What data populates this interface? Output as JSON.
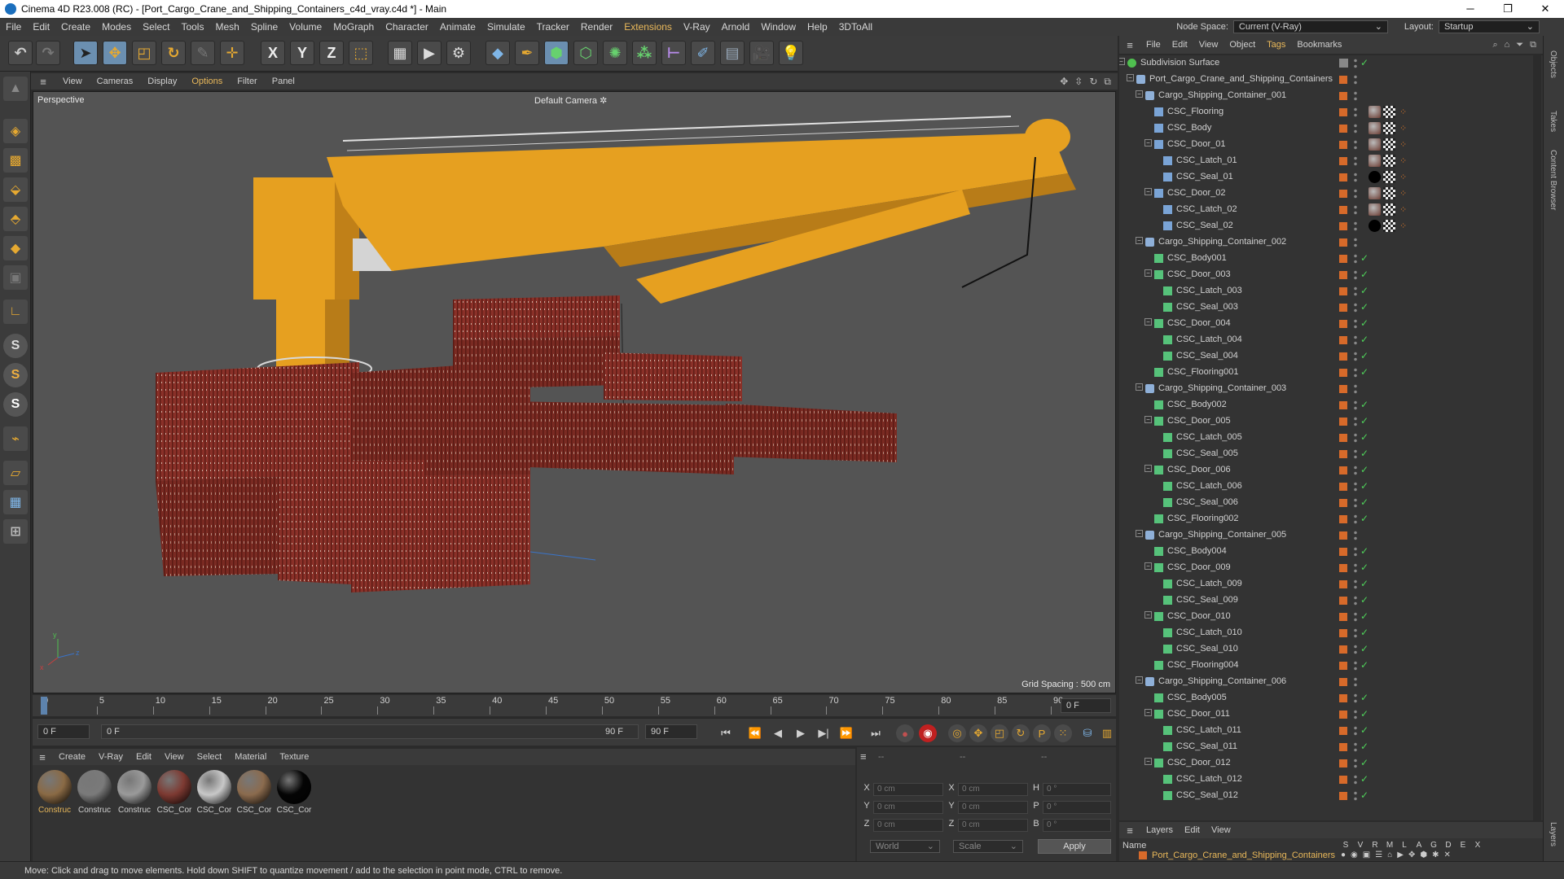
{
  "window": {
    "title": "Cinema 4D R23.008 (RC) - [Port_Cargo_Crane_and_Shipping_Containers_c4d_vray.c4d *] - Main",
    "min": "─",
    "restore": "❐",
    "close": "✕"
  },
  "menu": [
    "File",
    "Edit",
    "Create",
    "Modes",
    "Select",
    "Tools",
    "Mesh",
    "Spline",
    "Volume",
    "MoGraph",
    "Character",
    "Animate",
    "Simulate",
    "Tracker",
    "Render",
    "Extensions",
    "V-Ray",
    "Arnold",
    "Window",
    "Help",
    "3DToAll"
  ],
  "menu_highlight": "Extensions",
  "node_space": {
    "label": "Node Space:",
    "value": "Current (V-Ray)"
  },
  "layout": {
    "label": "Layout:",
    "value": "Startup"
  },
  "toolbar": {
    "icons": [
      "undo-icon",
      "redo-icon",
      "select-icon",
      "move-icon",
      "scale-icon",
      "rotate-icon",
      "polygon-pen-icon",
      "transform-icon",
      "x-axis-icon",
      "y-axis-icon",
      "z-axis-icon",
      "coord-system-icon",
      "render-region-icon",
      "render-view-icon",
      "render-settings-icon",
      "cube-icon",
      "pen-icon",
      "subdivision-icon",
      "bend-icon",
      "array-icon",
      "cloner-icon",
      "field-icon",
      "sculpt-icon",
      "floor-icon",
      "camera-icon",
      "light-icon"
    ],
    "axis_labels": [
      "X",
      "Y",
      "Z"
    ]
  },
  "viewport": {
    "menu": [
      "View",
      "Cameras",
      "Display",
      "Options",
      "Filter",
      "Panel"
    ],
    "menu_highlight": "Options",
    "view_name": "Perspective",
    "camera": "Default Camera",
    "camera_suffix": "✲",
    "grid_spacing": "Grid Spacing : 500 cm"
  },
  "timeline": {
    "ticks": [
      "0",
      "5",
      "10",
      "15",
      "20",
      "25",
      "30",
      "35",
      "40",
      "45",
      "50",
      "55",
      "60",
      "65",
      "70",
      "75",
      "80",
      "85",
      "90"
    ],
    "end_field": "0 F",
    "current_frame": "0 F",
    "range_start": "0 F",
    "range_end": "90 F",
    "max_frame": "90 F"
  },
  "material_manager": {
    "menu": [
      "Create",
      "V-Ray",
      "Edit",
      "View",
      "Select",
      "Material",
      "Texture"
    ],
    "materials": [
      {
        "label": "Construc",
        "color": "#8a6a45",
        "selected": true
      },
      {
        "label": "Construc",
        "color": "#7a7a7a",
        "selected": false
      },
      {
        "label": "Construc",
        "color": "#9a9a9a",
        "selected": false
      },
      {
        "label": "CSC_Cor",
        "color": "#7d3a32",
        "selected": false
      },
      {
        "label": "CSC_Cor",
        "color": "#c8c8c8",
        "selected": false
      },
      {
        "label": "CSC_Cor",
        "color": "#8b6b4e",
        "selected": false
      },
      {
        "label": "CSC_Cor",
        "color": "#050505",
        "selected": false
      }
    ]
  },
  "coordinates": {
    "header1": "--",
    "header2": "--",
    "header3": "--",
    "rows": [
      {
        "a": "X",
        "av": "0 cm",
        "b": "X",
        "bv": "0 cm",
        "c": "H",
        "cv": "0 °"
      },
      {
        "a": "Y",
        "av": "0 cm",
        "b": "Y",
        "bv": "0 cm",
        "c": "P",
        "cv": "0 °"
      },
      {
        "a": "Z",
        "av": "0 cm",
        "b": "Z",
        "bv": "0 cm",
        "c": "B",
        "cv": "0 °"
      }
    ],
    "world": "World",
    "scale": "Scale",
    "apply": "Apply"
  },
  "status": "Move: Click and drag to move elements. Hold down SHIFT to quantize movement / add to the selection in point mode, CTRL to remove.",
  "object_manager": {
    "menu": [
      "File",
      "Edit",
      "View",
      "Object",
      "Tags",
      "Bookmarks"
    ],
    "menu_highlight": "Tags",
    "rows": [
      {
        "name": "Subdivision Surface",
        "indent": 0,
        "icon": "subdiv",
        "toggle": "-",
        "tag": "none"
      },
      {
        "name": "Port_Cargo_Crane_and_Shipping_Containers",
        "indent": 1,
        "icon": "null",
        "toggle": "-",
        "tag": "none"
      },
      {
        "name": "Cargo_Shipping_Container_001",
        "indent": 2,
        "icon": "null",
        "toggle": "-",
        "tag": "none"
      },
      {
        "name": "CSC_Flooring",
        "indent": 3,
        "icon": "bone",
        "toggle": "",
        "tag": "mat"
      },
      {
        "name": "CSC_Body",
        "indent": 3,
        "icon": "bone",
        "toggle": "",
        "tag": "mat"
      },
      {
        "name": "CSC_Door_01",
        "indent": 3,
        "icon": "bone",
        "toggle": "-",
        "tag": "mat"
      },
      {
        "name": "CSC_Latch_01",
        "indent": 4,
        "icon": "bone",
        "toggle": "",
        "tag": "mat"
      },
      {
        "name": "CSC_Seal_01",
        "indent": 4,
        "icon": "bone",
        "toggle": "",
        "tag": "black"
      },
      {
        "name": "CSC_Door_02",
        "indent": 3,
        "icon": "bone",
        "toggle": "-",
        "tag": "mat"
      },
      {
        "name": "CSC_Latch_02",
        "indent": 4,
        "icon": "bone",
        "toggle": "",
        "tag": "mat"
      },
      {
        "name": "CSC_Seal_02",
        "indent": 4,
        "icon": "bone",
        "toggle": "",
        "tag": "black"
      },
      {
        "name": "Cargo_Shipping_Container_002",
        "indent": 2,
        "icon": "null",
        "toggle": "-",
        "tag": "none"
      },
      {
        "name": "CSC_Body001",
        "indent": 3,
        "icon": "poly",
        "toggle": "",
        "tag": "check"
      },
      {
        "name": "CSC_Door_003",
        "indent": 3,
        "icon": "poly",
        "toggle": "-",
        "tag": "check"
      },
      {
        "name": "CSC_Latch_003",
        "indent": 4,
        "icon": "poly",
        "toggle": "",
        "tag": "check"
      },
      {
        "name": "CSC_Seal_003",
        "indent": 4,
        "icon": "poly",
        "toggle": "",
        "tag": "check"
      },
      {
        "name": "CSC_Door_004",
        "indent": 3,
        "icon": "poly",
        "toggle": "-",
        "tag": "check"
      },
      {
        "name": "CSC_Latch_004",
        "indent": 4,
        "icon": "poly",
        "toggle": "",
        "tag": "check"
      },
      {
        "name": "CSC_Seal_004",
        "indent": 4,
        "icon": "poly",
        "toggle": "",
        "tag": "check"
      },
      {
        "name": "CSC_Flooring001",
        "indent": 3,
        "icon": "poly",
        "toggle": "",
        "tag": "check"
      },
      {
        "name": "Cargo_Shipping_Container_003",
        "indent": 2,
        "icon": "null",
        "toggle": "-",
        "tag": "none"
      },
      {
        "name": "CSC_Body002",
        "indent": 3,
        "icon": "poly",
        "toggle": "",
        "tag": "check"
      },
      {
        "name": "CSC_Door_005",
        "indent": 3,
        "icon": "poly",
        "toggle": "-",
        "tag": "check"
      },
      {
        "name": "CSC_Latch_005",
        "indent": 4,
        "icon": "poly",
        "toggle": "",
        "tag": "check"
      },
      {
        "name": "CSC_Seal_005",
        "indent": 4,
        "icon": "poly",
        "toggle": "",
        "tag": "check"
      },
      {
        "name": "CSC_Door_006",
        "indent": 3,
        "icon": "poly",
        "toggle": "-",
        "tag": "check"
      },
      {
        "name": "CSC_Latch_006",
        "indent": 4,
        "icon": "poly",
        "toggle": "",
        "tag": "check"
      },
      {
        "name": "CSC_Seal_006",
        "indent": 4,
        "icon": "poly",
        "toggle": "",
        "tag": "check"
      },
      {
        "name": "CSC_Flooring002",
        "indent": 3,
        "icon": "poly",
        "toggle": "",
        "tag": "check"
      },
      {
        "name": "Cargo_Shipping_Container_005",
        "indent": 2,
        "icon": "null",
        "toggle": "-",
        "tag": "none"
      },
      {
        "name": "CSC_Body004",
        "indent": 3,
        "icon": "poly",
        "toggle": "",
        "tag": "check"
      },
      {
        "name": "CSC_Door_009",
        "indent": 3,
        "icon": "poly",
        "toggle": "-",
        "tag": "check"
      },
      {
        "name": "CSC_Latch_009",
        "indent": 4,
        "icon": "poly",
        "toggle": "",
        "tag": "check"
      },
      {
        "name": "CSC_Seal_009",
        "indent": 4,
        "icon": "poly",
        "toggle": "",
        "tag": "check"
      },
      {
        "name": "CSC_Door_010",
        "indent": 3,
        "icon": "poly",
        "toggle": "-",
        "tag": "check"
      },
      {
        "name": "CSC_Latch_010",
        "indent": 4,
        "icon": "poly",
        "toggle": "",
        "tag": "check"
      },
      {
        "name": "CSC_Seal_010",
        "indent": 4,
        "icon": "poly",
        "toggle": "",
        "tag": "check"
      },
      {
        "name": "CSC_Flooring004",
        "indent": 3,
        "icon": "poly",
        "toggle": "",
        "tag": "check"
      },
      {
        "name": "Cargo_Shipping_Container_006",
        "indent": 2,
        "icon": "null",
        "toggle": "-",
        "tag": "none"
      },
      {
        "name": "CSC_Body005",
        "indent": 3,
        "icon": "poly",
        "toggle": "",
        "tag": "check"
      },
      {
        "name": "CSC_Door_011",
        "indent": 3,
        "icon": "poly",
        "toggle": "-",
        "tag": "check"
      },
      {
        "name": "CSC_Latch_011",
        "indent": 4,
        "icon": "poly",
        "toggle": "",
        "tag": "check"
      },
      {
        "name": "CSC_Seal_011",
        "indent": 4,
        "icon": "poly",
        "toggle": "",
        "tag": "check"
      },
      {
        "name": "CSC_Door_012",
        "indent": 3,
        "icon": "poly",
        "toggle": "-",
        "tag": "check"
      },
      {
        "name": "CSC_Latch_012",
        "indent": 4,
        "icon": "poly",
        "toggle": "",
        "tag": "check"
      },
      {
        "name": "CSC_Seal_012",
        "indent": 4,
        "icon": "poly",
        "toggle": "",
        "tag": "check"
      }
    ]
  },
  "right_dock_tabs": [
    "Objects",
    "Takes",
    "Content Browser"
  ],
  "layer_dock_tab": "Layers",
  "layer_manager": {
    "menu": [
      "Layers",
      "Edit",
      "View"
    ],
    "name_header": "Name",
    "columns": [
      "S",
      "V",
      "R",
      "M",
      "L",
      "A",
      "G",
      "D",
      "E",
      "X"
    ],
    "layer_name": "Port_Cargo_Crane_and_Shipping_Containers"
  },
  "colors": {
    "accent": "#e9b85a",
    "layer_orange": "#d76a2a",
    "check_green": "#4fd15a",
    "crane_yellow": "#e6a020",
    "container_red": "#7a2a22"
  }
}
